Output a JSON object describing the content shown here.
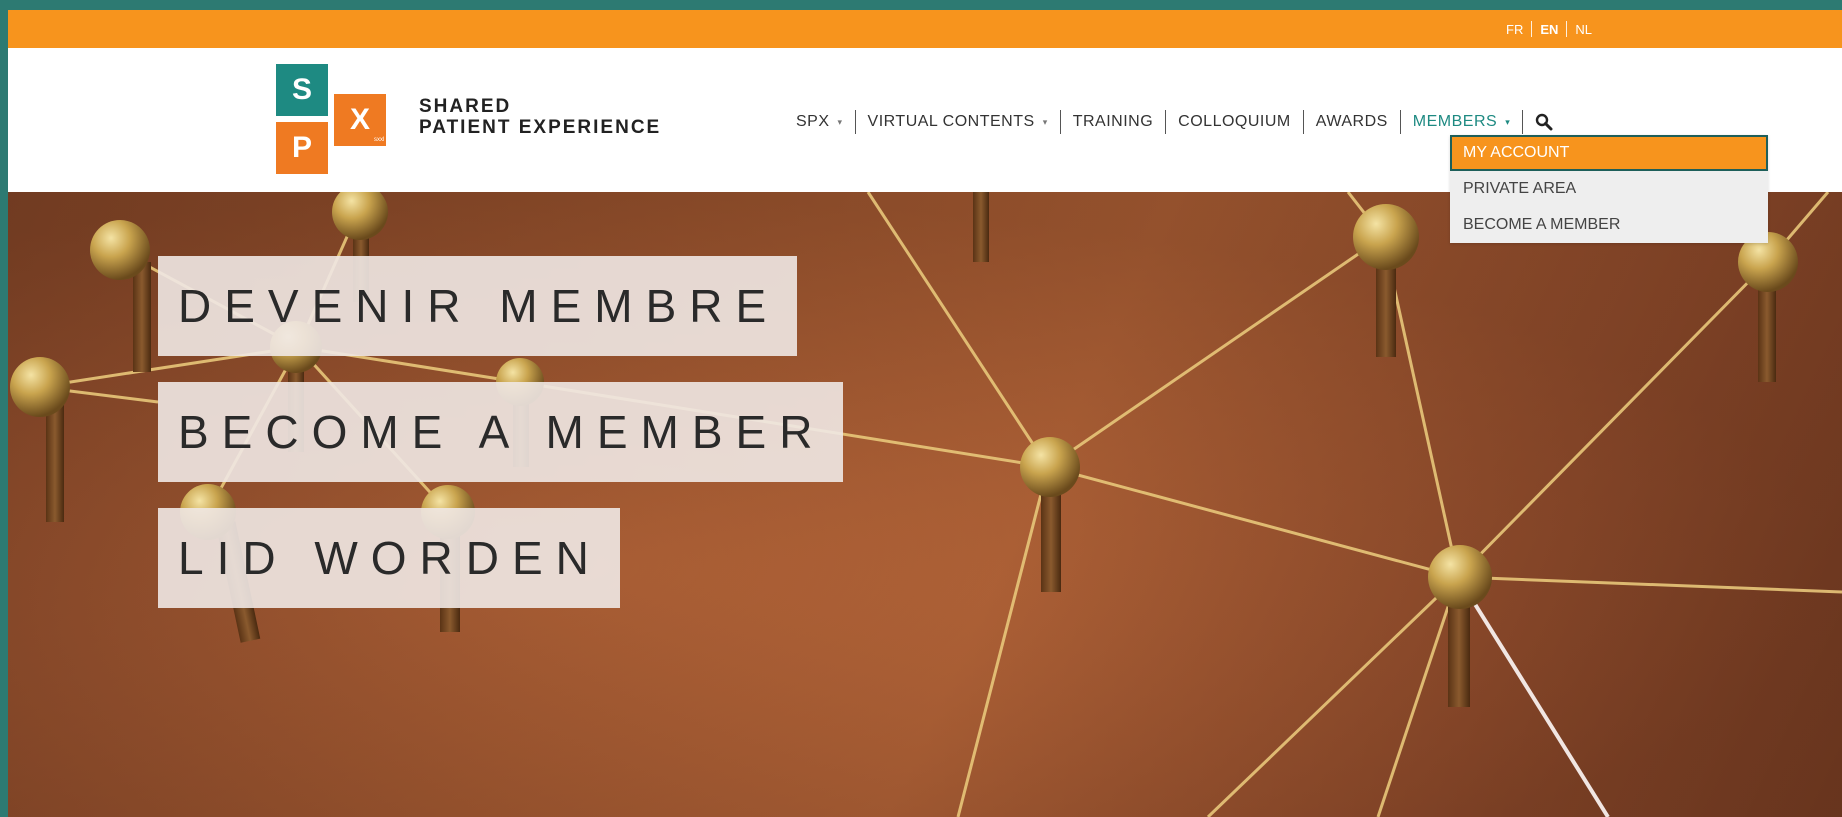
{
  "languages": {
    "fr": "FR",
    "en": "EN",
    "nl": "NL",
    "active": "EN"
  },
  "brand": {
    "logo_letters": [
      "S",
      "X",
      "P"
    ],
    "logo_tiny": "sxxl",
    "line1": "SHARED",
    "line2": "PATIENT EXPERIENCE",
    "colors": {
      "teal": "#1e8a82",
      "orange": "#ef7a22"
    }
  },
  "nav": {
    "spx": "SPX",
    "virtual_contents": "VIRTUAL CONTENTS",
    "training": "TRAINING",
    "colloquium": "COLLOQUIUM",
    "awards": "AWARDS",
    "members": "MEMBERS",
    "search_icon": "search-icon"
  },
  "members_dropdown": {
    "items": [
      "MY ACCOUNT",
      "PRIVATE AREA",
      "BECOME A MEMBER"
    ],
    "selected": "MY ACCOUNT"
  },
  "hero": {
    "lines": [
      "DEVENIR MEMBRE",
      "BECOME A MEMBER",
      "LID WORDEN"
    ]
  },
  "colors": {
    "accent_orange": "#f7941d",
    "accent_teal": "#1e8a82"
  }
}
